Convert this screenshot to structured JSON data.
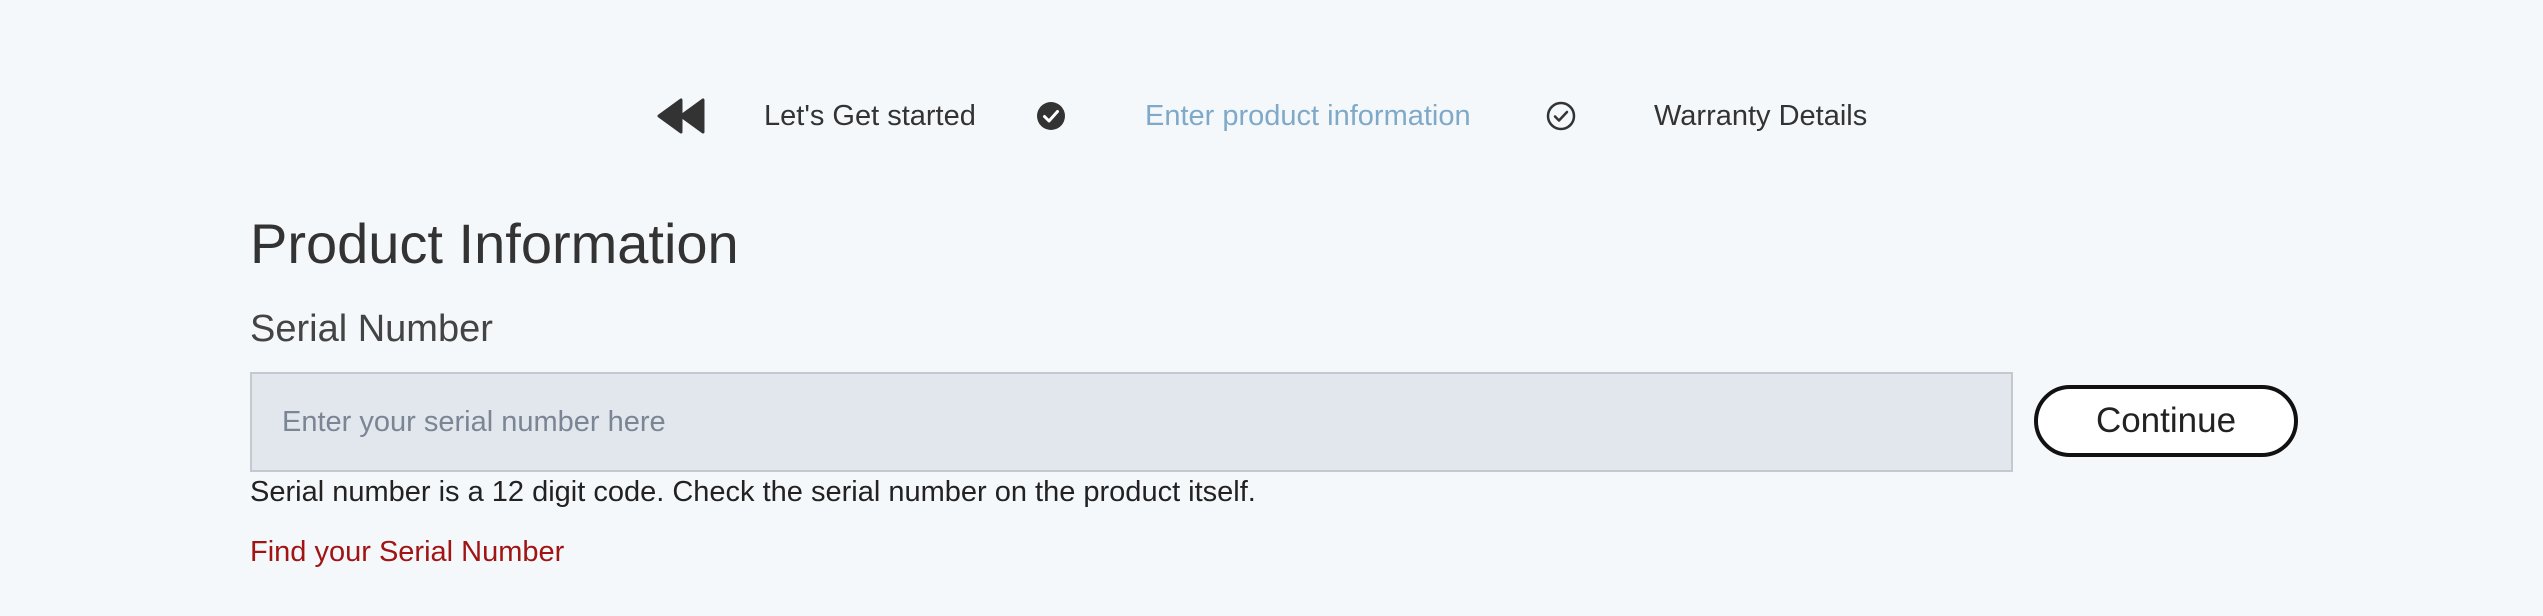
{
  "steps": {
    "back_icon": "double-chevron-left-icon",
    "items": [
      {
        "label": "Let's Get started",
        "state": "completed"
      },
      {
        "label": "Enter product information",
        "state": "active"
      },
      {
        "label": "Warranty Details",
        "state": "upcoming"
      }
    ],
    "check_icons": [
      "check-circle-filled-icon",
      "check-circle-outline-icon"
    ]
  },
  "form": {
    "title": "Product Information",
    "serial_label": "Serial Number",
    "serial_value": "",
    "serial_placeholder": "Enter your serial number here",
    "continue_label": "Continue",
    "helper_text": "Serial number is a 12 digit code. Check the serial number on the product itself.",
    "find_link_label": "Find your Serial Number"
  },
  "colors": {
    "background": "#f5f8fb",
    "active_step": "#7fa9c8",
    "link": "#a01414",
    "input_background": "#e2e7ee",
    "text": "#333333"
  }
}
